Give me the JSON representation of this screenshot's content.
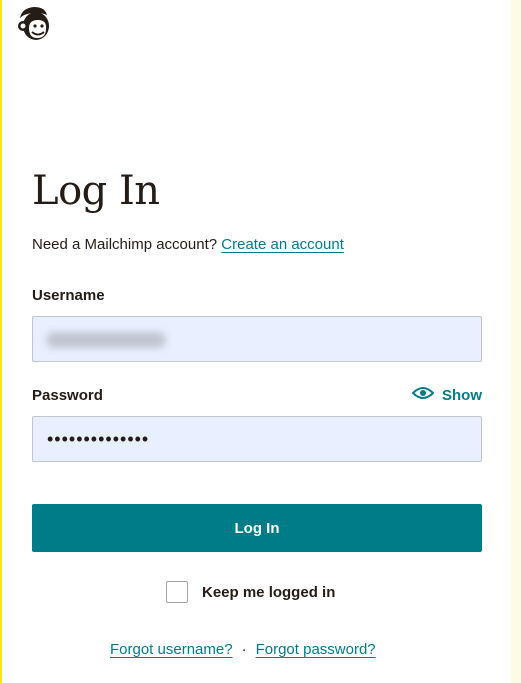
{
  "page": {
    "title": "Log In"
  },
  "signup": {
    "prompt": "Need a Mailchimp account?",
    "link_label": "Create an account"
  },
  "username": {
    "label": "Username",
    "value": ""
  },
  "password": {
    "label": "Password",
    "value": "••••••••••••••",
    "show_label": "Show"
  },
  "actions": {
    "login_label": "Log In"
  },
  "remember": {
    "label": "Keep me logged in",
    "checked": false
  },
  "forgot": {
    "username_label": "Forgot username?",
    "separator": "·",
    "password_label": "Forgot password?"
  },
  "icons": {
    "logo": "mailchimp-freddie-logo-icon",
    "show_password": "eye-icon"
  },
  "colors": {
    "accent": "#007c89",
    "brand_yellow": "#ffe01b",
    "text": "#241c15",
    "input_background": "#e8efff"
  }
}
